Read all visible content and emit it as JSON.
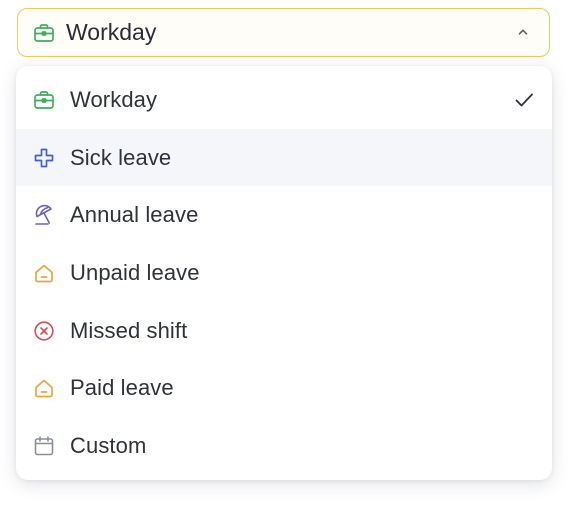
{
  "select": {
    "selected_label": "Workday",
    "selected_icon": "briefcase-icon",
    "expanded": true,
    "border_color": "#f2c85a"
  },
  "options": [
    {
      "label": "Workday",
      "icon": "briefcase-icon",
      "color": "#3fae5a",
      "selected": true
    },
    {
      "label": "Sick leave",
      "icon": "medical-cross-icon",
      "color": "#3f63d6",
      "hovered": true
    },
    {
      "label": "Annual leave",
      "icon": "beach-umbrella-icon",
      "color": "#6b5fd6"
    },
    {
      "label": "Unpaid leave",
      "icon": "house-icon",
      "color": "#f0a23a"
    },
    {
      "label": "Missed shift",
      "icon": "x-circle-icon",
      "color": "#e0484f"
    },
    {
      "label": "Paid leave",
      "icon": "house-icon",
      "color": "#f0a23a"
    },
    {
      "label": "Custom",
      "icon": "calendar-icon",
      "color": "#8a8f9c"
    }
  ]
}
